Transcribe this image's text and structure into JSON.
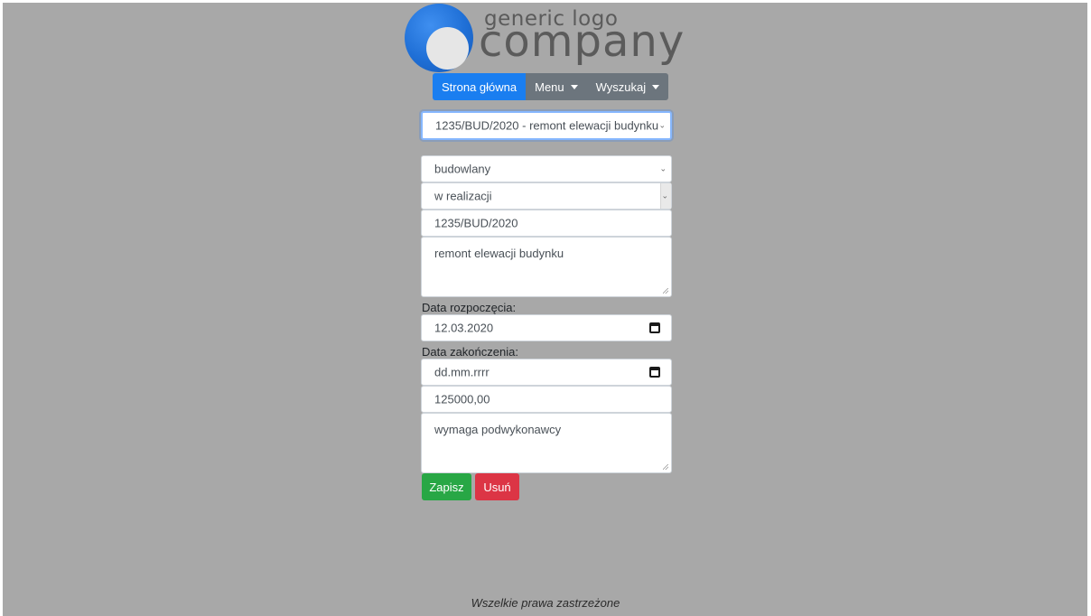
{
  "logo": {
    "top_text": "generic logo",
    "main_text": "company",
    "circle_color": "#1f6fd6"
  },
  "nav": {
    "home_label": "Strona główna",
    "menu_label": "Menu",
    "search_label": "Wyszukaj"
  },
  "form": {
    "project_select_value": "1235/BUD/2020 - remont elewacji budynku",
    "type_value": "budowlany",
    "status_value": "w realizacji",
    "number_value": "1235/BUD/2020",
    "description_value": "remont elewacji budynku",
    "start_date_label": "Data rozpoczęcia:",
    "start_date_value": "12.03.2020",
    "end_date_label": "Data zakończenia:",
    "end_date_placeholder": "dd.mm.rrrr",
    "amount_value": "125000,00",
    "notes_value": "wymaga podwykonawcy",
    "save_label": "Zapisz",
    "delete_label": "Usuń"
  },
  "footer": {
    "text": "Wszelkie prawa zastrzeżone"
  },
  "colors": {
    "background": "#a8a8a8",
    "primary": "#1a7ef0",
    "secondary": "#6c757d",
    "success": "#28a745",
    "danger": "#dc3545"
  }
}
